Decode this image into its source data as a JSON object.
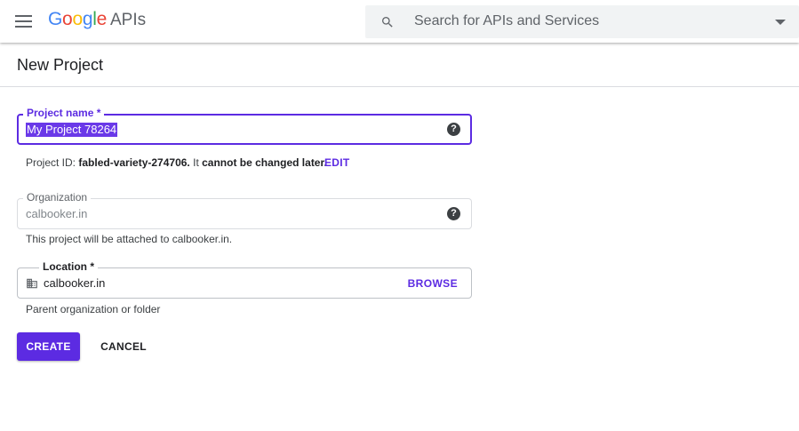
{
  "header": {
    "logo_google": "Google",
    "logo_apis": "APIs",
    "search_placeholder": "Search for APIs and Services",
    "logo_colors": [
      "#4285F4",
      "#EA4335",
      "#FBBC05",
      "#4285F4",
      "#34A853",
      "#EA4335"
    ]
  },
  "page": {
    "title": "New Project"
  },
  "form": {
    "project_name": {
      "label": "Project name *",
      "value": "My Project 78264",
      "help_icon": "help-icon"
    },
    "project_id_hint": {
      "prefix": "Project ID:",
      "id": "fabled-variety-274706.",
      "middle": "It",
      "bold_suffix": "cannot be changed later.",
      "edit_label": "EDIT"
    },
    "organization": {
      "label": "Organization",
      "value": "calbooker.in",
      "hint": "This project will be attached to calbooker.in."
    },
    "location": {
      "label": "Location *",
      "value": "calbooker.in",
      "browse_label": "BROWSE",
      "icon": "building-icon",
      "hint": "Parent organization or folder"
    },
    "create_label": "CREATE",
    "cancel_label": "CANCEL"
  },
  "colors": {
    "accent": "#5c2be2",
    "selection": "#6a39e8"
  }
}
